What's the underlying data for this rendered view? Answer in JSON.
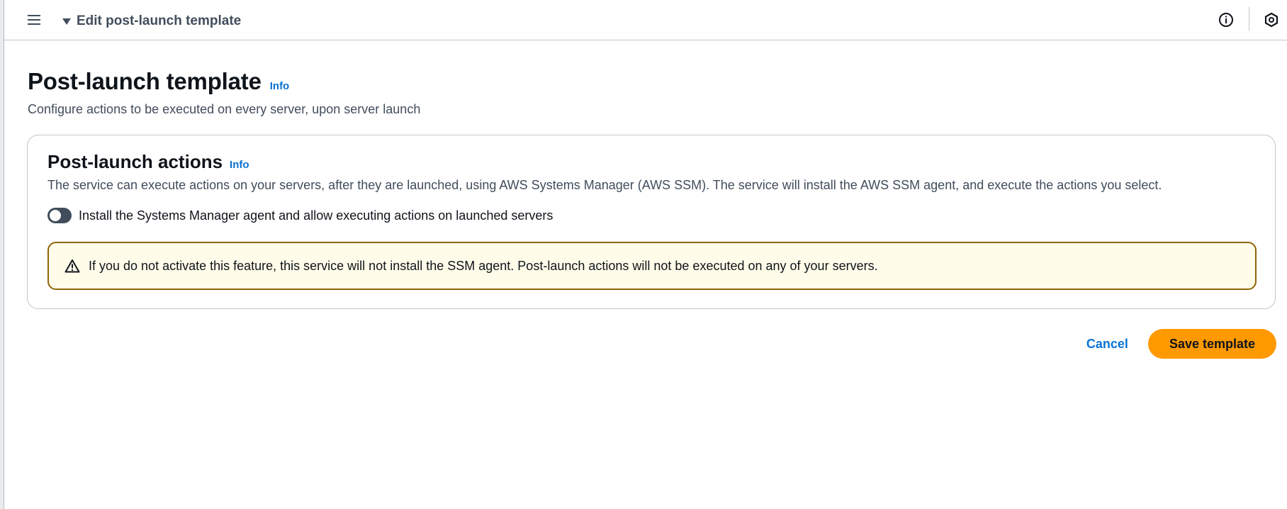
{
  "topbar": {
    "breadcrumb": "Edit post-launch template",
    "icons": [
      "menu-icon",
      "caret-down-icon",
      "info-circle-icon",
      "hexagon-icon"
    ]
  },
  "page": {
    "title": "Post-launch template",
    "info_label": "Info",
    "description": "Configure actions to be executed on every server, upon server launch"
  },
  "section": {
    "title": "Post-launch actions",
    "info_label": "Info",
    "description": "The service can execute actions on your servers, after they are launched, using AWS Systems Manager (AWS SSM). The service will install the AWS SSM agent, and execute the actions you select.",
    "toggle_label": "Install the Systems Manager agent and allow executing actions on launched servers",
    "toggle_on": false,
    "alert_text": "If you do not activate this feature, this service will not install the SSM agent. Post-launch actions will not be executed on any of your servers."
  },
  "actions": {
    "cancel_label": "Cancel",
    "save_label": "Save template"
  },
  "colors": {
    "accent_link": "#0972d3",
    "primary_button": "#ff9900",
    "warning_border": "#8d6605",
    "warning_bg": "#fffce9"
  }
}
